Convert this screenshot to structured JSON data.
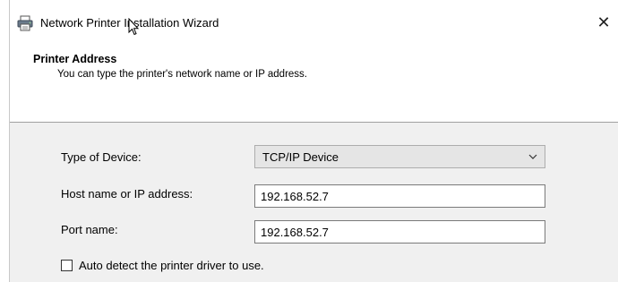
{
  "window": {
    "title": "Network Printer Installation Wizard",
    "close_glyph": "✕"
  },
  "header": {
    "title": "Printer Address",
    "subtitle": "You can type the printer's network name or IP address."
  },
  "form": {
    "device_type": {
      "label": "Type of Device:",
      "selected": "TCP/IP Device"
    },
    "host": {
      "label": "Host name or IP address:",
      "value": "192.168.52.7"
    },
    "port": {
      "label": "Port name:",
      "value": "192.168.52.7"
    },
    "auto_detect": {
      "label": "Auto detect the printer driver to use.",
      "checked": false
    }
  },
  "icons": {
    "title_icon": "printer-icon",
    "select_arrow": "chevron-down-icon",
    "close": "close-icon"
  }
}
